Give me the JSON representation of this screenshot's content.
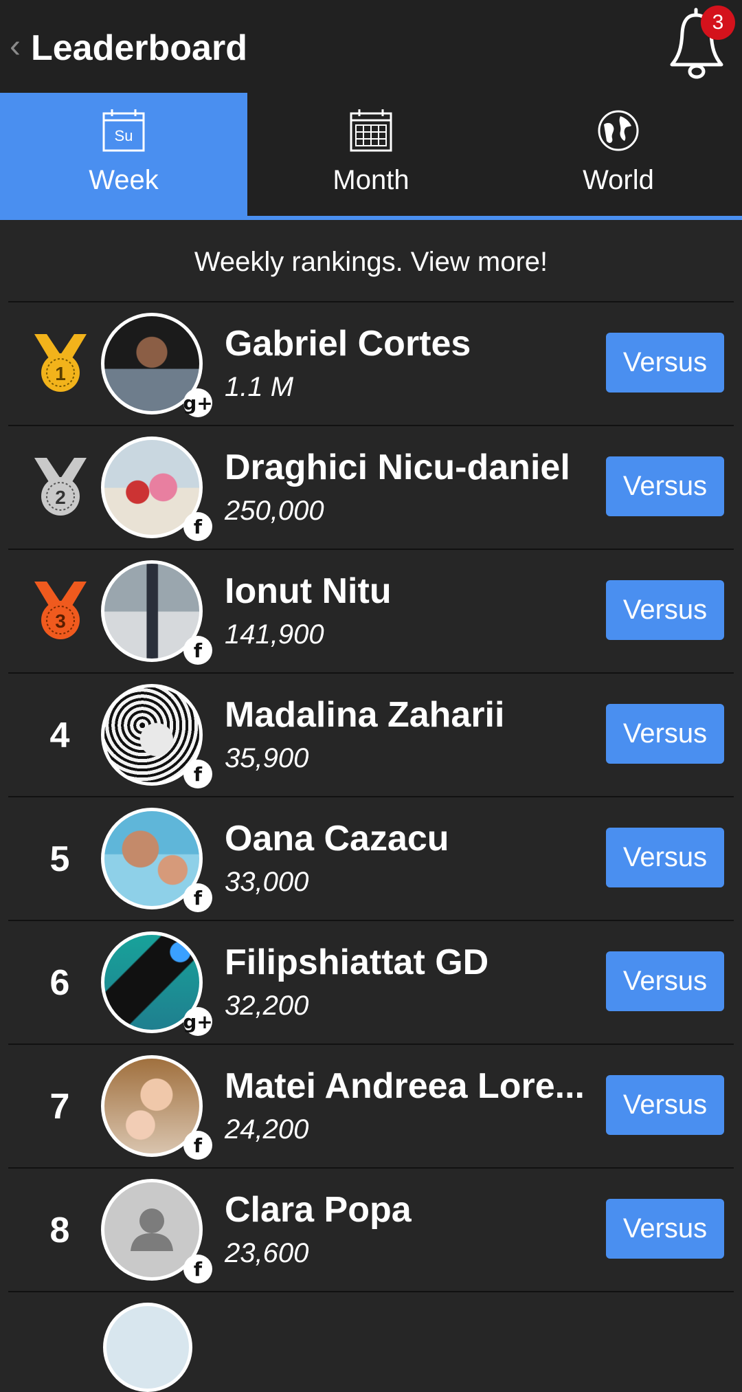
{
  "header": {
    "title": "Leaderboard",
    "notification_count": "3"
  },
  "tabs": [
    {
      "label": "Week",
      "icon_text": "Su",
      "icon": "calendar-day-icon",
      "active": true
    },
    {
      "label": "Month",
      "icon": "calendar-month-icon",
      "active": false
    },
    {
      "label": "World",
      "icon": "globe-icon",
      "active": false
    }
  ],
  "subtitle": "Weekly rankings. View more!",
  "versus_label": "Versus",
  "colors": {
    "accent": "#4a8ff0",
    "background": "#262626",
    "gold": "#f2b31b",
    "silver": "#c9c9c9",
    "bronze": "#f05a1e",
    "badge": "#d4121c"
  },
  "players": [
    {
      "rank": "1",
      "medal": "gold",
      "name": "Gabriel Cortes",
      "score": "1.1 M",
      "source": "g+"
    },
    {
      "rank": "2",
      "medal": "silver",
      "name": "Draghici Nicu-daniel",
      "score": "250,000",
      "source": "f"
    },
    {
      "rank": "3",
      "medal": "bronze",
      "name": "Ionut Nitu",
      "score": "141,900",
      "source": "f"
    },
    {
      "rank": "4",
      "name": "Madalina Zaharii",
      "score": "35,900",
      "source": "f"
    },
    {
      "rank": "5",
      "name": "Oana Cazacu",
      "score": "33,000",
      "source": "f"
    },
    {
      "rank": "6",
      "name": "Filipshiattat GD",
      "score": "32,200",
      "source": "g+"
    },
    {
      "rank": "7",
      "name": "Matei Andreea Lore...",
      "score": "24,200",
      "source": "f"
    },
    {
      "rank": "8",
      "name": "Clara Popa",
      "score": "23,600",
      "source": "f"
    }
  ]
}
